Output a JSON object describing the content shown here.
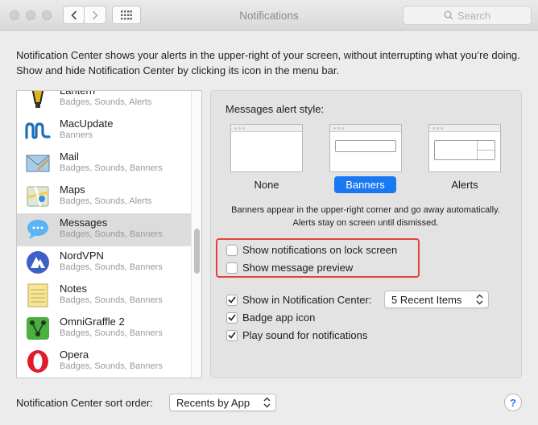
{
  "window": {
    "title": "Notifications",
    "search_placeholder": "Search"
  },
  "description": "Notification Center shows your alerts in the upper-right of your screen, without interrupting what you’re doing. Show and hide Notification Center by clicking its icon in the menu bar.",
  "apps": [
    {
      "name": "Lantern",
      "sub": "Badges, Sounds, Alerts",
      "icon": "lantern-icon"
    },
    {
      "name": "MacUpdate",
      "sub": "Banners",
      "icon": "macupdate-icon"
    },
    {
      "name": "Mail",
      "sub": "Badges, Sounds, Banners",
      "icon": "mail-icon"
    },
    {
      "name": "Maps",
      "sub": "Badges, Sounds, Alerts",
      "icon": "maps-icon"
    },
    {
      "name": "Messages",
      "sub": "Badges, Sounds, Banners",
      "icon": "messages-icon"
    },
    {
      "name": "NordVPN",
      "sub": "Badges, Sounds, Banners",
      "icon": "nordvpn-icon"
    },
    {
      "name": "Notes",
      "sub": "Badges, Sounds, Banners",
      "icon": "notes-icon"
    },
    {
      "name": "OmniGraffle 2",
      "sub": "Badges, Sounds, Banners",
      "icon": "omnigraffle-icon"
    },
    {
      "name": "Opera",
      "sub": "Badges, Sounds, Banners",
      "icon": "opera-icon"
    }
  ],
  "selected_app": "Messages",
  "settings": {
    "alert_style_label": "Messages alert style:",
    "styles": {
      "none": "None",
      "banners": "Banners",
      "alerts": "Alerts"
    },
    "selected_style": "Banners",
    "explanation": "Banners appear in the upper-right corner and go away automatically. Alerts stay on screen until dismissed.",
    "lock_screen": {
      "label": "Show notifications on lock screen",
      "checked": false
    },
    "message_preview": {
      "label": "Show message preview",
      "checked": false
    },
    "show_in_nc": {
      "label": "Show in Notification Center:",
      "checked": true
    },
    "recent_items": "5 Recent Items",
    "badge_icon": {
      "label": "Badge app icon",
      "checked": true
    },
    "play_sound": {
      "label": "Play sound for notifications",
      "checked": true
    }
  },
  "footer": {
    "sort_label": "Notification Center sort order:",
    "sort_value": "Recents by App",
    "help": "?"
  },
  "colors": {
    "accent": "#1a79f2",
    "highlight": "#e0443c"
  }
}
